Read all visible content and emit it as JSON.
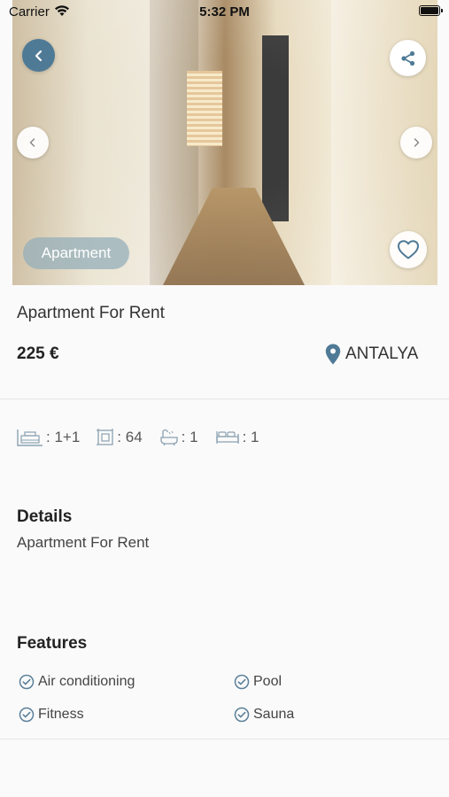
{
  "status_bar": {
    "carrier": "Carrier",
    "time": "5:32 PM"
  },
  "listing": {
    "category": "Apartment",
    "title": "Apartment For Rent",
    "price": "225 €",
    "location": "ANTALYA"
  },
  "specs": {
    "rooms": ": 1+1",
    "area": ": 64",
    "bathrooms": ": 1",
    "bedrooms": ": 1"
  },
  "details": {
    "heading": "Details",
    "text": "Apartment For Rent"
  },
  "features": {
    "heading": "Features",
    "items": [
      "Air conditioning",
      "Pool",
      "Fitness",
      "Sauna"
    ]
  },
  "colors": {
    "accent": "#4f7a96",
    "pill": "#96afb9",
    "check": "#5a7f99"
  }
}
